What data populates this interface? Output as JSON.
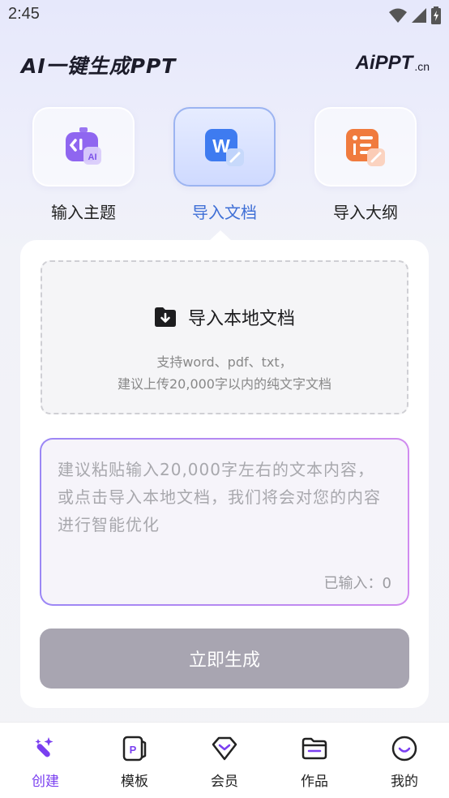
{
  "status_bar": {
    "time": "2:45"
  },
  "header": {
    "title": "AI一键生成PPT",
    "brand": {
      "main": "PPT",
      "prefix": "Ai",
      "suffix": ".cn"
    }
  },
  "mode_tabs": [
    {
      "label": "输入主题",
      "icon": "robot-ai-icon",
      "active": false
    },
    {
      "label": "导入文档",
      "icon": "word-document-icon",
      "active": true
    },
    {
      "label": "导入大纲",
      "icon": "outline-list-icon",
      "active": false
    }
  ],
  "upload": {
    "title": "导入本地文档",
    "hint_line1": "支持word、pdf、txt，",
    "hint_line2": "建议上传20,000字以内的纯文字文档",
    "icon": "folder-download-icon"
  },
  "text_input": {
    "placeholder": "建议粘贴输入20,000字左右的文本内容，或点击导入本地文档，我们将会对您的内容进行智能优化",
    "count_label": "已输入：",
    "count_value": "0"
  },
  "generate_button": {
    "label": "立即生成",
    "color": "#a8a5b1"
  },
  "bottom_nav": [
    {
      "label": "创建",
      "icon": "magic-wand-icon",
      "active": true
    },
    {
      "label": "模板",
      "icon": "ppt-template-icon",
      "active": false
    },
    {
      "label": "会员",
      "icon": "diamond-icon",
      "active": false
    },
    {
      "label": "作品",
      "icon": "folder-icon",
      "active": false
    },
    {
      "label": "我的",
      "icon": "smile-profile-icon",
      "active": false
    }
  ],
  "colors": {
    "accent": "#7a3ff0",
    "active_tab": "#3f6fd6"
  }
}
